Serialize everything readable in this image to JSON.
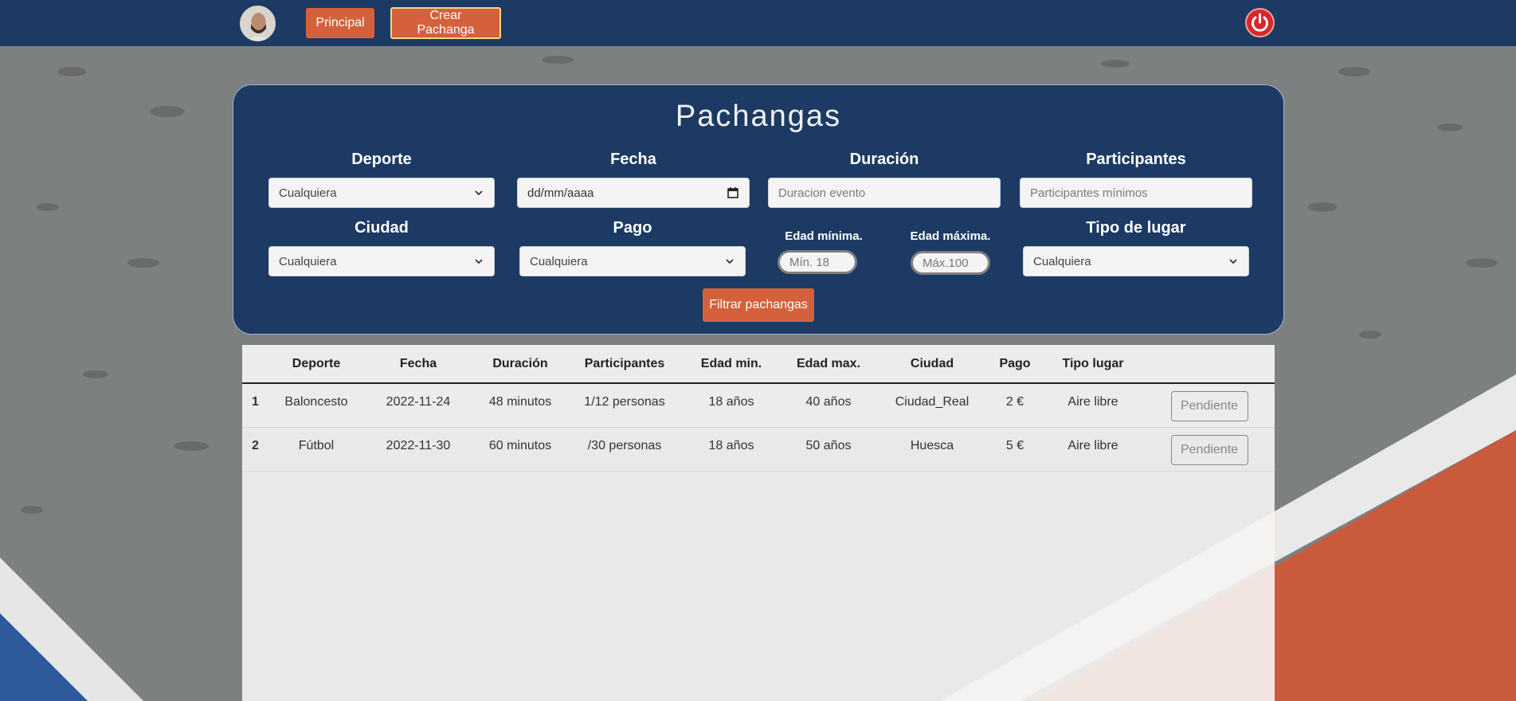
{
  "nav": {
    "principal_label": "Principal",
    "crear_label": "Crear Pachanga"
  },
  "filters": {
    "title": "Pachangas",
    "deporte": {
      "label": "Deporte",
      "value": "Cualquiera"
    },
    "fecha": {
      "label": "Fecha",
      "placeholder": "dd/mm/aaaa"
    },
    "duracion": {
      "label": "Duración",
      "placeholder": "Duracion evento"
    },
    "participantes": {
      "label": "Participantes",
      "placeholder": "Participantes mínimos"
    },
    "ciudad": {
      "label": "Ciudad",
      "value": "Cualquiera"
    },
    "pago": {
      "label": "Pago",
      "value": "Cualquiera"
    },
    "edad_min": {
      "label": "Edad mínima.",
      "placeholder": "Mín. 18"
    },
    "edad_max": {
      "label": "Edad máxima.",
      "placeholder": "Máx.100"
    },
    "tipo_lugar": {
      "label": "Tipo de lugar",
      "value": "Cualquiera"
    },
    "button_label": "Filtrar pachangas"
  },
  "table": {
    "headers": [
      "",
      "Deporte",
      "Fecha",
      "Duración",
      "Participantes",
      "Edad min.",
      "Edad max.",
      "Ciudad",
      "Pago",
      "Tipo lugar",
      ""
    ],
    "rows": [
      {
        "num": "1",
        "deporte": "Baloncesto",
        "fecha": "2022-11-24",
        "duracion": "48 minutos",
        "participantes": "1/12 personas",
        "edad_min": "18 años",
        "edad_max": "40 años",
        "ciudad": "Ciudad_Real",
        "pago": "2 €",
        "tipo": "Aire libre",
        "action": "Pendiente"
      },
      {
        "num": "2",
        "deporte": "Fútbol",
        "fecha": "2022-11-30",
        "duracion": "60 minutos",
        "participantes": "/30 personas",
        "edad_min": "18 años",
        "edad_max": "50 años",
        "ciudad": "Huesca",
        "pago": "5 €",
        "tipo": "Aire libre",
        "action": "Pendiente"
      }
    ]
  },
  "colors": {
    "navbar": "#1c3a63",
    "accent": "#d4613c",
    "power": "#d8262b"
  }
}
